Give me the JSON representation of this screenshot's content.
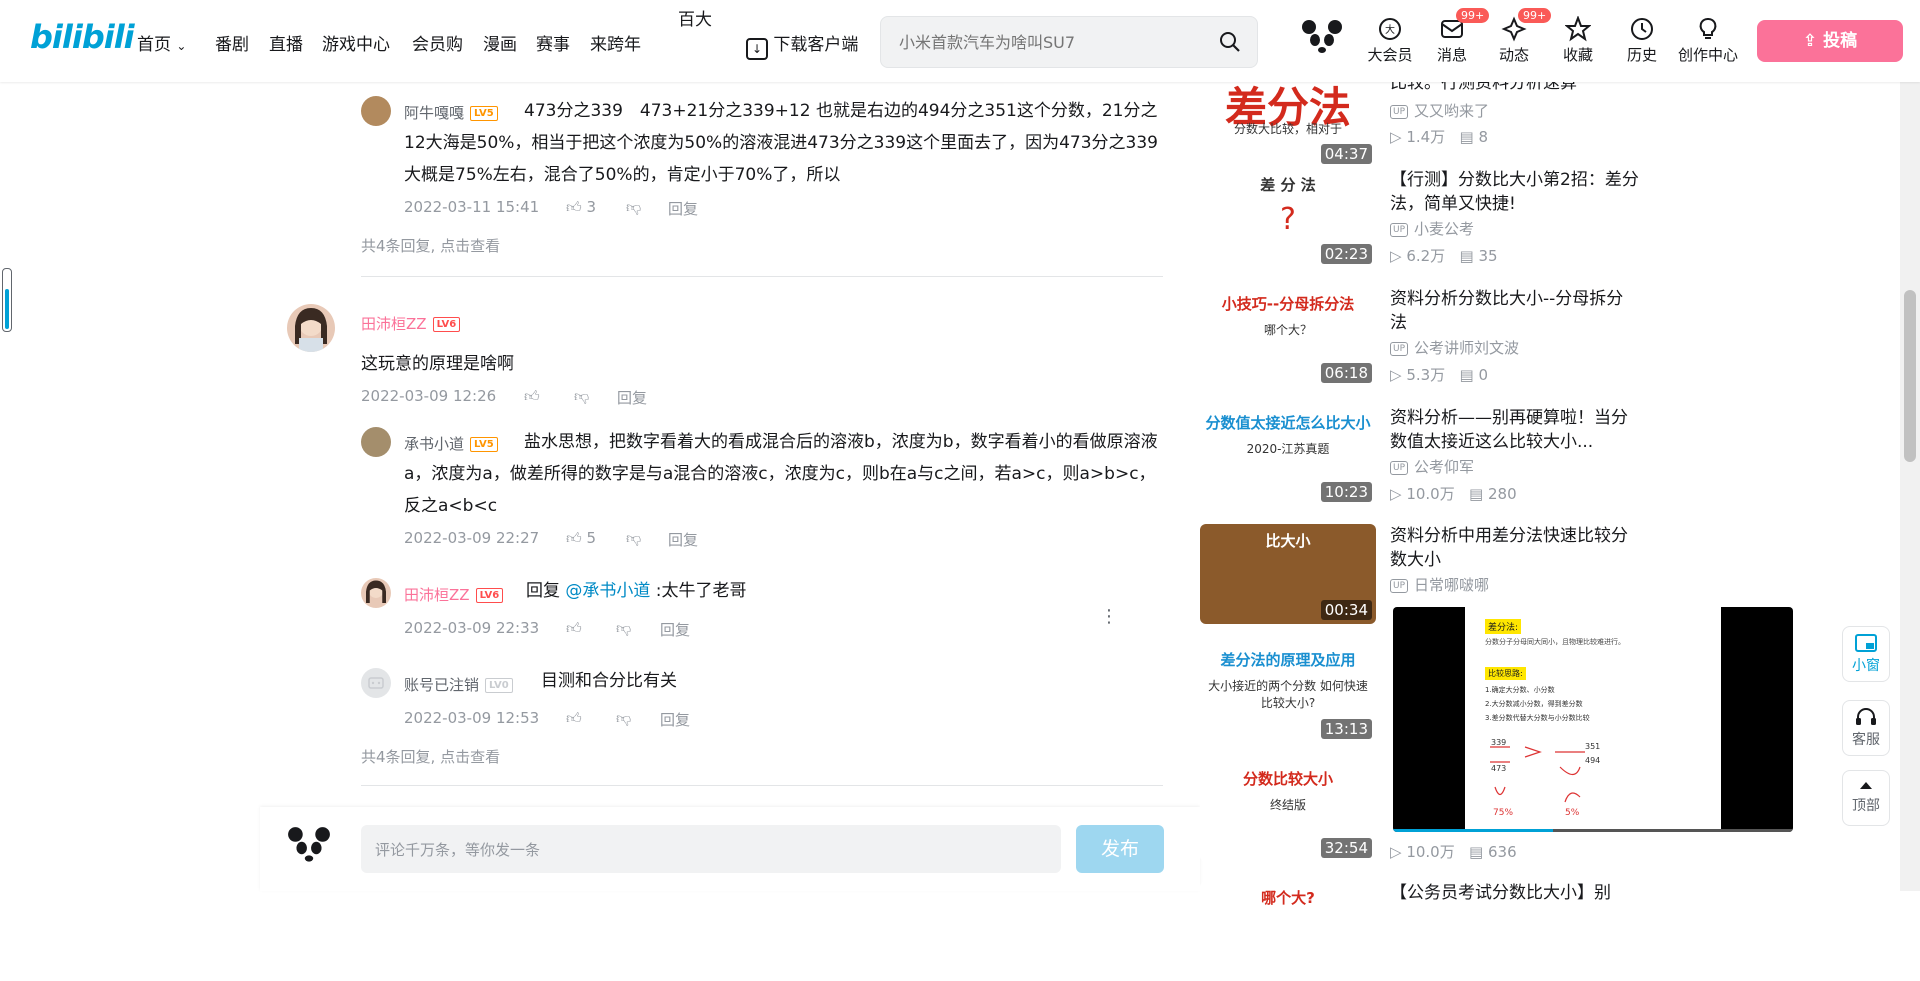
{
  "header": {
    "logo": "bilibili",
    "nav": [
      "首页",
      "番剧",
      "直播",
      "游戏中心",
      "会员购",
      "漫画",
      "赛事",
      "来跨年"
    ],
    "floating_text": "百大",
    "download": "下载客户端",
    "search_placeholder": "小米首款汽车为啥叫SU7",
    "icons": [
      {
        "label": "大会员",
        "icon": "vip-icon"
      },
      {
        "label": "消息",
        "icon": "message-icon",
        "badge": "99+"
      },
      {
        "label": "动态",
        "icon": "dynamic-icon",
        "badge": "99+"
      },
      {
        "label": "收藏",
        "icon": "star-icon"
      },
      {
        "label": "历史",
        "icon": "clock-icon"
      },
      {
        "label": "创作中心",
        "icon": "bulb-icon"
      }
    ],
    "upload": "投稿"
  },
  "comments": {
    "c1": {
      "user": "阿牛嘎嘎",
      "level": "LV5",
      "text": "473分之339　473+21分之339+12 也就是右边的494分之351这个分数，21分之12大海是50%，相当于把这个浓度为50%的溶液混进473分之339这个里面去了，因为473分之339大概是75%左右，混合了50%的，肯定小于70%了，所以",
      "time": "2022-03-11 15:41",
      "likes": "3",
      "reply": "回复"
    },
    "more1": "共4条回复, 点击查看",
    "main": {
      "user": "田沛桓ZZ",
      "level": "LV6",
      "text": "这玩意的原理是啥啊",
      "time": "2022-03-09 12:26",
      "reply": "回复"
    },
    "r1": {
      "user": "承书小道",
      "level": "LV5",
      "text": "盐水思想，把数字看着大的看成混合后的溶液b，浓度为b，数字看着小的看做原溶液a，浓度为a，做差所得的数字是与a混合的溶液c，浓度为c，则b在a与c之间，若a>c，则a>b>c，反之a<b<c",
      "time": "2022-03-09 22:27",
      "likes": "5",
      "reply": "回复"
    },
    "r2": {
      "user": "田沛桓ZZ",
      "level": "LV6",
      "prefix": "回复 ",
      "mention": "@承书小道",
      "text": " :太牛了老哥",
      "time": "2022-03-09 22:33",
      "reply": "回复"
    },
    "r3": {
      "user": "账号已注销",
      "level": "LV0",
      "text": "目测和合分比有关",
      "time": "2022-03-09 12:53",
      "reply": "回复"
    },
    "more2": "共4条回复, 点击查看"
  },
  "bottom": {
    "placeholder": "评论千万条，等你发一条",
    "send": "发布"
  },
  "videos": [
    {
      "title": "比较。行测资料分析速算",
      "up": "又又哟来了",
      "views": "1.4万",
      "danmaku": "8",
      "duration": "04:37",
      "thumb_text": "差分法",
      "thumb_sub": "分数大比较，相对于",
      "color": "#d32a1d"
    },
    {
      "title": "【行测】分数比大小第2招：差分法，简单又快捷!",
      "up": "小麦公考",
      "views": "6.2万",
      "danmaku": "35",
      "duration": "02:23",
      "thumb_text": "差 分 法",
      "thumb_sub": "?",
      "color": "#333333"
    },
    {
      "title": "资料分析分数比大小--分母拆分法",
      "up": "公考讲师刘文波",
      "views": "5.3万",
      "danmaku": "0",
      "duration": "06:18",
      "thumb_text": "小技巧--分母拆分法",
      "thumb_sub": "哪个大？",
      "color": "#d32a1d"
    },
    {
      "title": "资料分析——别再硬算啦！当分数值太接近这么比较大小...",
      "up": "公考仰军",
      "views": "10.0万",
      "danmaku": "280",
      "duration": "10:23",
      "thumb_text": "分数值太接近怎么比大小",
      "thumb_sub": "2020-江苏真题",
      "color": "#1a8fd0"
    },
    {
      "title": "资料分析中用差分法快速比较分数大小",
      "up": "日常哪啵哪",
      "views": "",
      "danmaku": "",
      "duration": "00:34",
      "thumb_text": "比大小",
      "thumb_sub": "",
      "color": "#6b4423"
    },
    {
      "title": "",
      "up": "",
      "views": "",
      "danmaku": "",
      "duration": "13:13",
      "thumb_text": "差分法的原理及应用",
      "thumb_sub": "大小接近的两个分数 如何快速比较大小?",
      "color": "#1a8fd0"
    },
    {
      "title": "",
      "up": "",
      "views": "10.0万",
      "danmaku": "636",
      "duration": "32:54",
      "thumb_text": "分数比较大小",
      "thumb_sub": "终结版",
      "color": "#d32a1d"
    },
    {
      "title": "【公务员考试分数比大小】别",
      "up": "",
      "views": "",
      "danmaku": "",
      "duration": "",
      "thumb_text": "哪个大?",
      "thumb_sub": "",
      "color": "#d32a1d"
    }
  ],
  "mini_player": {
    "title": "差分法:",
    "line1": "分数分子分母同大同小，且物理比较难进行。",
    "line2": "比较思路:",
    "steps": [
      "1.确定大分数、小分数",
      "2.大分数减小分数，得到差分数",
      "3.差分数代替大分数与小分数比较"
    ],
    "progress": 0.4
  },
  "side_buttons": [
    "小窗",
    "客服",
    "顶部"
  ]
}
